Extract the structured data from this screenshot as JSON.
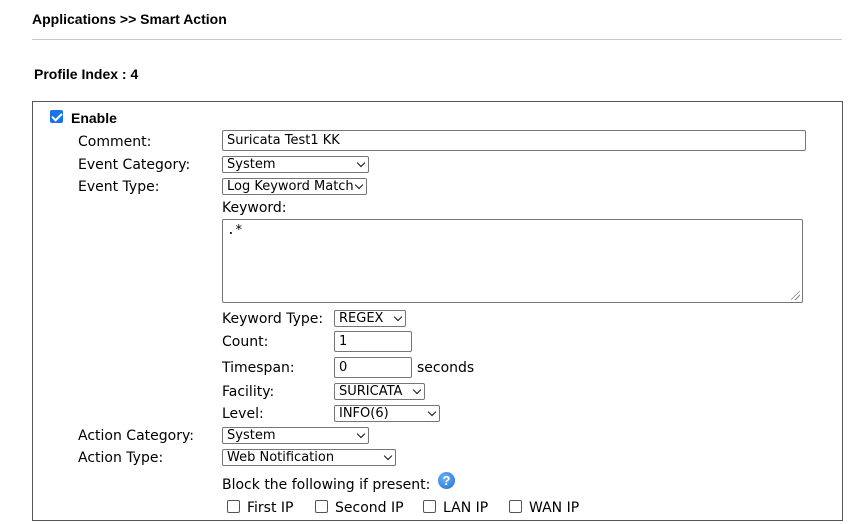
{
  "header": {
    "breadcrumb": "Applications >> Smart Action",
    "profile_index": "Profile Index : 4"
  },
  "form": {
    "enable_label": "Enable",
    "enable_checked": true,
    "comment": {
      "label": "Comment:",
      "value": "Suricata Test1 KK"
    },
    "event_category": {
      "label": "Event Category:",
      "value": "System"
    },
    "event_type": {
      "label": "Event Type:",
      "value": "Log Keyword Match"
    },
    "keyword": {
      "label": "Keyword:",
      "value": ".*"
    },
    "keyword_type": {
      "label": "Keyword Type:",
      "value": "REGEX"
    },
    "count": {
      "label": "Count:",
      "value": "1"
    },
    "timespan": {
      "label": "Timespan:",
      "value": "0",
      "unit": "seconds"
    },
    "facility": {
      "label": "Facility:",
      "value": "SURICATA"
    },
    "level": {
      "label": "Level:",
      "value": "INFO(6)"
    },
    "action_category": {
      "label": "Action Category:",
      "value": "System"
    },
    "action_type": {
      "label": "Action Type:",
      "value": "Web Notification"
    },
    "block": {
      "label": "Block the following if present:",
      "help_icon": "?",
      "options": [
        {
          "label": "First IP",
          "checked": false
        },
        {
          "label": "Second IP",
          "checked": false
        },
        {
          "label": "LAN IP",
          "checked": false
        },
        {
          "label": "WAN IP",
          "checked": false
        }
      ]
    }
  },
  "colors": {
    "checkbox_accent": "#1a73e8",
    "help_icon": "#1b6fd1",
    "panel_border": "#555555"
  }
}
